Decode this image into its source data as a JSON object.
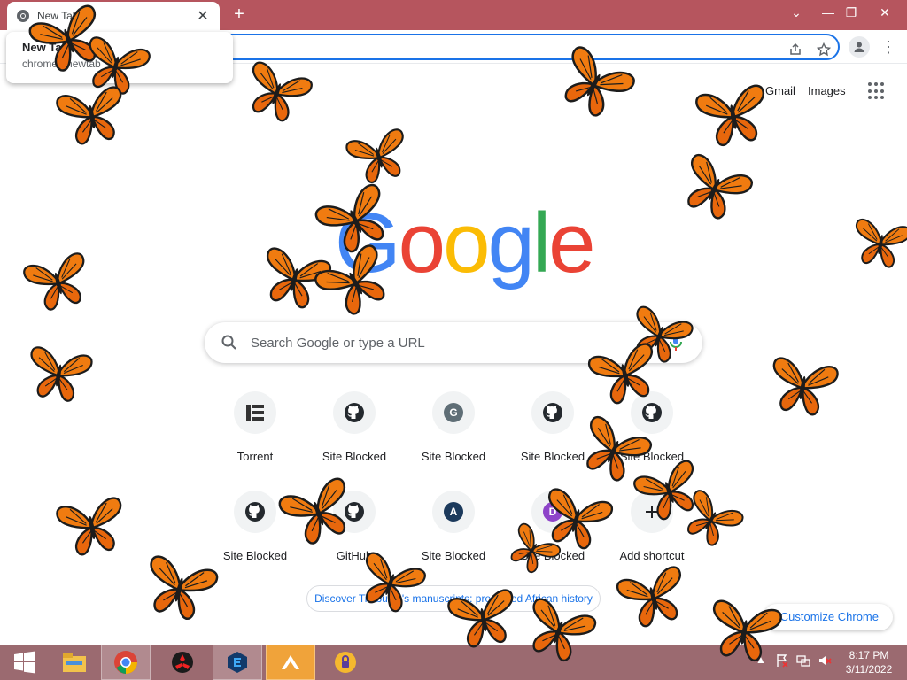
{
  "browser": {
    "tab": {
      "title": "New Tab",
      "close_label": "✕"
    },
    "new_tab_label": "+",
    "window_controls": {
      "tabsearch": "⌄",
      "minimize": "—",
      "restore": "❐",
      "close": "✕"
    },
    "hover_card": {
      "title": "New Tab",
      "subtitle": "chrome://newtab"
    },
    "omnibox": {
      "value": ""
    },
    "menu_label": "⋮"
  },
  "ntp": {
    "links": {
      "gmail": "Gmail",
      "images": "Images"
    },
    "logo_letters": [
      {
        "char": "G",
        "color": "#4285f4"
      },
      {
        "char": "o",
        "color": "#ea4335"
      },
      {
        "char": "o",
        "color": "#fbbc05"
      },
      {
        "char": "g",
        "color": "#4285f4"
      },
      {
        "char": "l",
        "color": "#34a853"
      },
      {
        "char": "e",
        "color": "#ea4335"
      }
    ],
    "search_placeholder": "Search Google or type a URL",
    "shortcuts_row1": [
      {
        "label": "Torrent",
        "icon": "torrent-icon"
      },
      {
        "label": "Site Blocked",
        "icon": "github-icon"
      },
      {
        "label": "Site Blocked",
        "icon": "letter-icon",
        "letter": "G",
        "color": "#5f6e76"
      },
      {
        "label": "Site Blocked",
        "icon": "github-icon"
      },
      {
        "label": "Site Blocked",
        "icon": "github-icon"
      }
    ],
    "shortcuts_row2": [
      {
        "label": "Site Blocked",
        "icon": "github-icon"
      },
      {
        "label": "GitHub",
        "icon": "github-icon"
      },
      {
        "label": "Site Blocked",
        "icon": "letter-icon",
        "letter": "A",
        "color": "#1c3a5c"
      },
      {
        "label": "Site Blocked",
        "icon": "letter-icon",
        "letter": "D",
        "color": "#8e44c9"
      },
      {
        "label": "Add shortcut",
        "icon": "plus-icon"
      }
    ],
    "promo": {
      "text": "Discover Timbuktu's manuscripts: preserved African history"
    },
    "customize_label": "Customize Chrome"
  },
  "taskbar": {
    "apps": [
      "start-icon",
      "file-explorer-icon",
      "chrome-icon",
      "red-app-icon",
      "blue-app-icon",
      "orange-app-icon",
      "vpn-app-icon"
    ],
    "tray_arrow": "▲",
    "clock": {
      "time": "8:17 PM",
      "date": "3/11/2022"
    }
  },
  "colors": {
    "titlebar": "#b6555e",
    "taskbar": "#9b6a70",
    "accent": "#1a73e8",
    "butterfly": "#f07b10"
  }
}
